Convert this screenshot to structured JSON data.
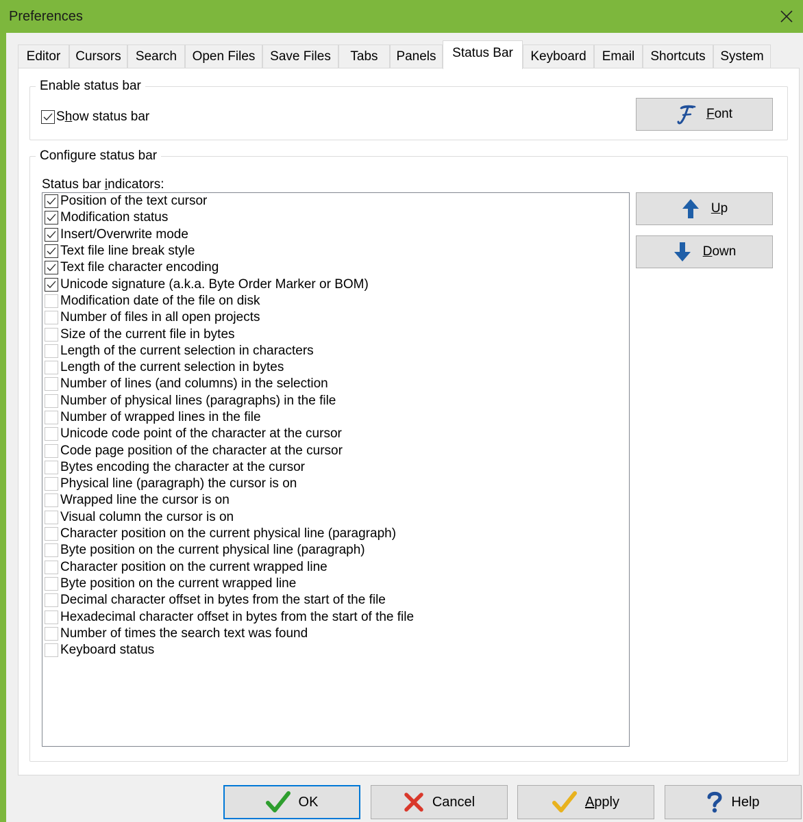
{
  "window": {
    "title": "Preferences"
  },
  "tabs": [
    {
      "label": "Editor"
    },
    {
      "label": "Cursors"
    },
    {
      "label": "Search"
    },
    {
      "label": "Open Files"
    },
    {
      "label": "Save Files"
    },
    {
      "label": "Tabs"
    },
    {
      "label": "Panels"
    },
    {
      "label": "Status Bar",
      "active": true
    },
    {
      "label": "Keyboard"
    },
    {
      "label": "Email"
    },
    {
      "label": "Shortcuts"
    },
    {
      "label": "System"
    }
  ],
  "enable_group": {
    "title": "Enable status bar",
    "show_status_bar": {
      "pre": "S",
      "mnemonic": "h",
      "post": "ow status bar",
      "checked": true
    },
    "font_button": {
      "pre": "",
      "mnemonic": "F",
      "post": "ont"
    }
  },
  "config_group": {
    "title": "Configure status bar",
    "list_label": {
      "pre": "Status bar ",
      "mnemonic": "i",
      "post": "ndicators:"
    },
    "indicators": [
      {
        "label": "Position of the text cursor",
        "checked": true
      },
      {
        "label": "Modification status",
        "checked": true
      },
      {
        "label": "Insert/Overwrite mode",
        "checked": true
      },
      {
        "label": "Text file line break style",
        "checked": true
      },
      {
        "label": "Text file character encoding",
        "checked": true
      },
      {
        "label": "Unicode signature (a.k.a. Byte Order Marker or BOM)",
        "checked": true
      },
      {
        "label": "Modification date of the file on disk",
        "checked": false
      },
      {
        "label": "Number of files in all open projects",
        "checked": false
      },
      {
        "label": "Size of the current file in bytes",
        "checked": false
      },
      {
        "label": "Length of the current selection in characters",
        "checked": false
      },
      {
        "label": "Length of the current selection in bytes",
        "checked": false
      },
      {
        "label": "Number of lines (and columns) in the selection",
        "checked": false
      },
      {
        "label": "Number of physical lines (paragraphs) in the file",
        "checked": false
      },
      {
        "label": "Number of wrapped lines in the file",
        "checked": false
      },
      {
        "label": "Unicode code point of the character at the cursor",
        "checked": false
      },
      {
        "label": "Code page position of the character at the cursor",
        "checked": false
      },
      {
        "label": "Bytes encoding the character at the cursor",
        "checked": false
      },
      {
        "label": "Physical line (paragraph) the cursor is on",
        "checked": false
      },
      {
        "label": "Wrapped line the cursor is on",
        "checked": false
      },
      {
        "label": "Visual column the cursor is on",
        "checked": false
      },
      {
        "label": "Character position on the current physical line (paragraph)",
        "checked": false
      },
      {
        "label": "Byte position on the current physical line (paragraph)",
        "checked": false
      },
      {
        "label": "Character position on the current wrapped line",
        "checked": false
      },
      {
        "label": "Byte position on the current wrapped line",
        "checked": false
      },
      {
        "label": "Decimal character offset in bytes from the start of the file",
        "checked": false
      },
      {
        "label": "Hexadecimal character offset in bytes from the start of the file",
        "checked": false
      },
      {
        "label": "Number of times the search text was found",
        "checked": false
      },
      {
        "label": "Keyboard status",
        "checked": false
      }
    ],
    "up_button": {
      "pre": "",
      "mnemonic": "U",
      "post": "p"
    },
    "down_button": {
      "pre": "",
      "mnemonic": "D",
      "post": "own"
    }
  },
  "footer": {
    "ok": "OK",
    "cancel": "Cancel",
    "apply": {
      "pre": "",
      "mnemonic": "A",
      "post": "pply"
    },
    "help": "Help"
  },
  "colors": {
    "titlebar": "#7db73d",
    "arrow": "#1f5fa8",
    "ok_check": "#2e9e2e",
    "cancel_x": "#d9382b",
    "apply_check": "#e8b21e",
    "help_q": "#1f4f9a"
  }
}
